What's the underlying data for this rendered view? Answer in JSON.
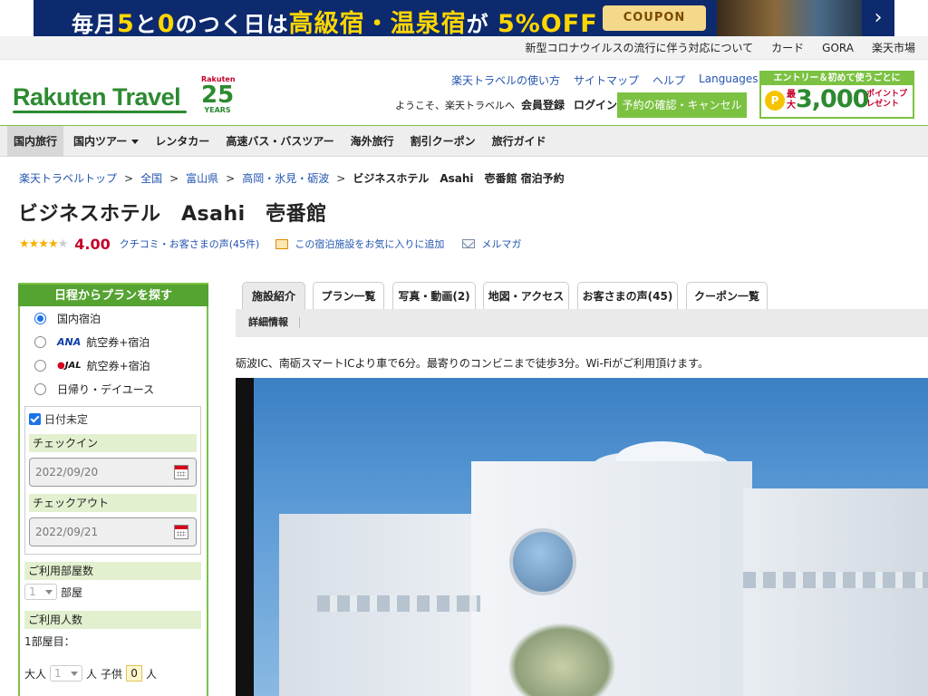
{
  "promo": {
    "text_a": "毎月",
    "text_5": "5",
    "text_b": "と",
    "text_0": "0",
    "text_c": "のつく日は",
    "text_d": "高級宿・温泉宿",
    "text_e": "が",
    "text_f": "5%OFF",
    "coupon": "COUPON",
    "next": "›"
  },
  "util_links": [
    "新型コロナウイルスの流行に伴う対応について",
    "カード",
    "GORA",
    "楽天市場"
  ],
  "header": {
    "logo": "Rakuten Travel",
    "anniv_small": "Rakuten",
    "anniv_num": "25",
    "anniv_years": "YEARS",
    "nav": [
      "楽天トラベルの使い方",
      "サイトマップ",
      "ヘルプ"
    ],
    "languages": "Languages",
    "welcome": "ようこそ、楽天トラベルへ",
    "register": "会員登録",
    "login": "ログイン",
    "reserve_button": "予約の確認・キャンセル",
    "ad_top": "エントリー＆初めて使うごとに",
    "ad_coin": "P",
    "ad_pre": "最大",
    "ad_big": "3,000",
    "ad_suf": "ポイントプレゼント"
  },
  "main_nav": [
    "国内旅行",
    "国内ツアー",
    "レンタカー",
    "高速バス・バスツアー",
    "海外旅行",
    "割引クーポン",
    "旅行ガイド"
  ],
  "breadcrumb": {
    "items": [
      "楽天トラベルトップ",
      "全国",
      "富山県",
      "高岡・氷見・砺波"
    ],
    "sep": ">",
    "current": "ビジネスホテル　Asahi　壱番館 宿泊予約"
  },
  "hotel": {
    "name": "ビジネスホテル　Asahi　壱番館",
    "rating": 4.0,
    "stars_filled": "★★★★",
    "stars_empty": "★",
    "score": "4.00",
    "review_link": "クチコミ・お客さまの声(45件)",
    "fav_link": "この宿泊施設をお気に入りに追加",
    "mail_link": "メルマガ"
  },
  "sidebar": {
    "title": "日程からプランを探す",
    "options": [
      {
        "label": "国内宿泊",
        "prefix": ""
      },
      {
        "label": "航空券+宿泊",
        "prefix": "ANA"
      },
      {
        "label": "航空券+宿泊",
        "prefix": "JAL"
      },
      {
        "label": "日帰り・デイユース",
        "prefix": ""
      }
    ],
    "jal_crane": "●",
    "undecided": "日付未定",
    "checkin_label": "チェックイン",
    "checkin_value": "2022/09/20",
    "checkout_label": "チェックアウト",
    "checkout_value": "2022/09/21",
    "rooms_label": "ご利用部屋数",
    "rooms_value": "1",
    "rooms_unit": "部屋",
    "people_label": "ご利用人数",
    "room1": "1部屋目：",
    "adult_label": "大人",
    "adult_value": "1",
    "person_unit": "人",
    "child_label": "子供",
    "child_value": "0"
  },
  "tabs": [
    "施設紹介",
    "プラン一覧",
    "写真・動画(2)",
    "地図・アクセス",
    "お客さまの声(45)",
    "クーポン一覧"
  ],
  "subtab": "詳細情報",
  "intro": "砺波IC、南砺スマートICより車で6分。最寄りのコンビニまで徒歩3分。Wi-Fiがご利用頂けます。",
  "colors": {
    "brand_green": "#2c8a31",
    "accent_green": "#7cc242",
    "link_blue": "#2355b0",
    "score_red": "#c4002b",
    "star": "#f3b200"
  }
}
